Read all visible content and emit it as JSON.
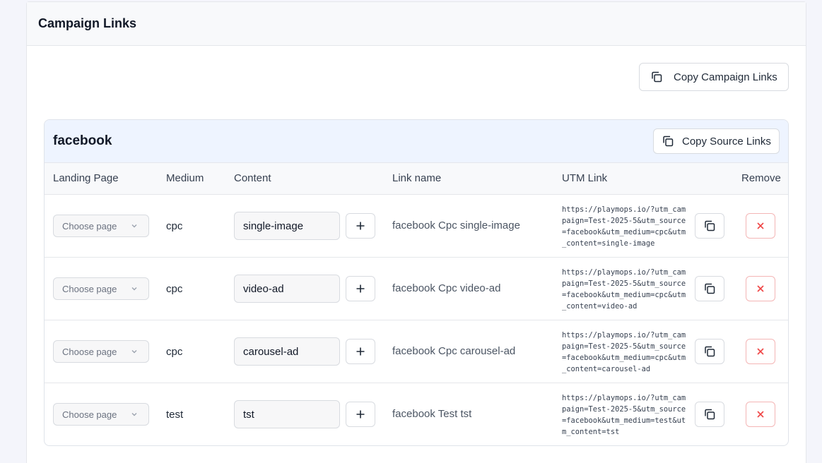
{
  "page": {
    "title": "Campaign Links"
  },
  "actions": {
    "copy_campaign_links": "Copy Campaign Links"
  },
  "source": {
    "name": "facebook",
    "copy_source_links": "Copy Source Links",
    "columns": {
      "landing_page": "Landing Page",
      "medium": "Medium",
      "content": "Content",
      "link_name": "Link name",
      "utm_link": "UTM Link",
      "remove": "Remove"
    },
    "rows": [
      {
        "landing_page_placeholder": "Choose page",
        "medium": "cpc",
        "content": "single-image",
        "link_name": "facebook Cpc single-image",
        "utm_link": "https://playmops.io/?utm_campaign=Test-2025-5&utm_source=facebook&utm_medium=cpc&utm_content=single-image"
      },
      {
        "landing_page_placeholder": "Choose page",
        "medium": "cpc",
        "content": "video-ad",
        "link_name": "facebook Cpc video-ad",
        "utm_link": "https://playmops.io/?utm_campaign=Test-2025-5&utm_source=facebook&utm_medium=cpc&utm_content=video-ad"
      },
      {
        "landing_page_placeholder": "Choose page",
        "medium": "cpc",
        "content": "carousel-ad",
        "link_name": "facebook Cpc carousel-ad",
        "utm_link": "https://playmops.io/?utm_campaign=Test-2025-5&utm_source=facebook&utm_medium=cpc&utm_content=carousel-ad"
      },
      {
        "landing_page_placeholder": "Choose page",
        "medium": "test",
        "content": "tst",
        "link_name": "facebook Test tst",
        "utm_link": "https://playmops.io/?utm_campaign=Test-2025-5&utm_source=facebook&utm_medium=test&utm_content=tst"
      }
    ]
  },
  "icons": {
    "copy": "copy-icon",
    "add": "plus-icon",
    "remove": "x-icon",
    "dropdown": "chevron-down-icon"
  },
  "colors": {
    "accent_danger": "#ef4444",
    "source_header_bg": "#eef4ff",
    "page_bg": "#f4f5fb"
  }
}
